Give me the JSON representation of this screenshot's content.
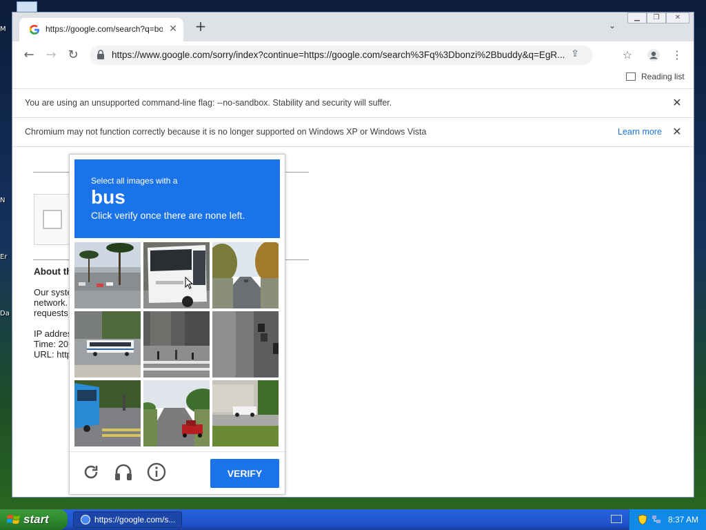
{
  "desktop": {
    "icon_labels": [
      "M",
      "N",
      "Er",
      "Da"
    ]
  },
  "browser": {
    "tab_title": "https://google.com/search?q=bonzi",
    "url": "https://www.google.com/sorry/index?continue=https://google.com/search%3Fq%3Dbonzi%2Bbuddy&q=EgR...",
    "reading_list_label": "Reading list",
    "infobars": [
      {
        "message": "You are using an unsupported command-line flag: --no-sandbox. Stability and security will suffer."
      },
      {
        "message": "Chromium may not function correctly because it is no longer supported on Windows XP or Windows Vista",
        "link": "Learn more"
      }
    ]
  },
  "page": {
    "heading": "About th",
    "body_lines": [
      "Our syste",
      "network.",
      "requests,"
    ],
    "ip_label": "IP addres",
    "time_label": "Time: 20",
    "url_label": "URL: http"
  },
  "captcha": {
    "instruction_line1": "Select all images with a",
    "target": "bus",
    "instruction_line2": "Click verify once there are none left.",
    "verify_label": "VERIFY",
    "tiles": [
      {
        "depicts": "palm trees parking lot"
      },
      {
        "depicts": "white coach bus"
      },
      {
        "depicts": "tree lined road"
      },
      {
        "depicts": "city bus street"
      },
      {
        "depicts": "crosswalk pedestrians"
      },
      {
        "depicts": "sidewalk scooters"
      },
      {
        "depicts": "blue bus front"
      },
      {
        "depicts": "highway red truck"
      },
      {
        "depicts": "house white car"
      }
    ]
  },
  "taskbar": {
    "start_label": "start",
    "task_title": "https://google.com/s...",
    "clock": "8:37 AM"
  },
  "colors": {
    "accent": "#1a73e8",
    "taskbar": "#245edb",
    "start_green": "#2e8a2e"
  }
}
